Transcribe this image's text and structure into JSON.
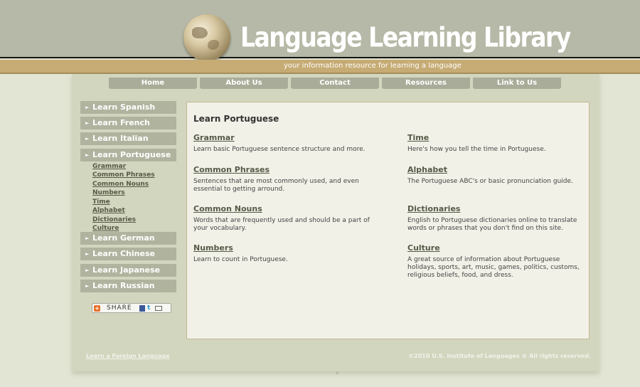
{
  "header": {
    "site_title": "Language Learning Library",
    "tagline": "your information resource for learning a language"
  },
  "topnav": [
    "Home",
    "About Us",
    "Contact",
    "Resources",
    "Link to Us"
  ],
  "sidebar": {
    "languages": [
      "Learn Spanish",
      "Learn French",
      "Learn Italian",
      "Learn Portuguese",
      "Learn German",
      "Learn Chinese",
      "Learn Japanese",
      "Learn Russian"
    ],
    "sub_items": [
      "Grammar",
      "Common Phrases",
      "Common Nouns",
      "Numbers",
      "Time",
      "Alphabet",
      "Dictionaries",
      "Culture"
    ],
    "share_label": "SHARE"
  },
  "content": {
    "title": "Learn Portuguese",
    "topics": [
      {
        "title": "Grammar",
        "desc": "Learn basic Portuguese sentence structure and more."
      },
      {
        "title": "Time",
        "desc": "Here's how you tell the time in Portuguese."
      },
      {
        "title": "Common Phrases",
        "desc": "Sentences that are most commonly used, and even essential to getting arround."
      },
      {
        "title": "Alphabet",
        "desc": "The Portuguese ABC's or basic pronunciation guide."
      },
      {
        "title": "Common Nouns",
        "desc": "Words that are frequently used and should be a part of your vocabulary."
      },
      {
        "title": "Dictionaries",
        "desc": "English to Portuguese dictionaries online to translate words or phrases that you don't find on this site."
      },
      {
        "title": "Numbers",
        "desc": "Learn to count in Portuguese."
      },
      {
        "title": "Culture",
        "desc": "A great source of information about Portuguese holidays, sports, art, music, games, politics, customs, religious beliefs, food, and dress."
      }
    ]
  },
  "footer": {
    "link": "Learn a Foreign Language",
    "copyright": "©2010 U.S. Institute of Languages ® All rights reserved."
  },
  "colors": {
    "header_bg": "#b6b9a7",
    "tagline_bg": "#c6ab74",
    "page_bg": "#e2e5d3",
    "wrapper_bg": "#d3d6bf",
    "nav_tab": "#a9ac98",
    "sidebar_item": "#b0b39e",
    "link_text": "#555a46",
    "content_bg": "#f1f1e8"
  },
  "icons": [
    "globe-logo",
    "arrow-icon",
    "addthis-plus-icon",
    "facebook-icon",
    "twitter-icon",
    "email-icon"
  ]
}
